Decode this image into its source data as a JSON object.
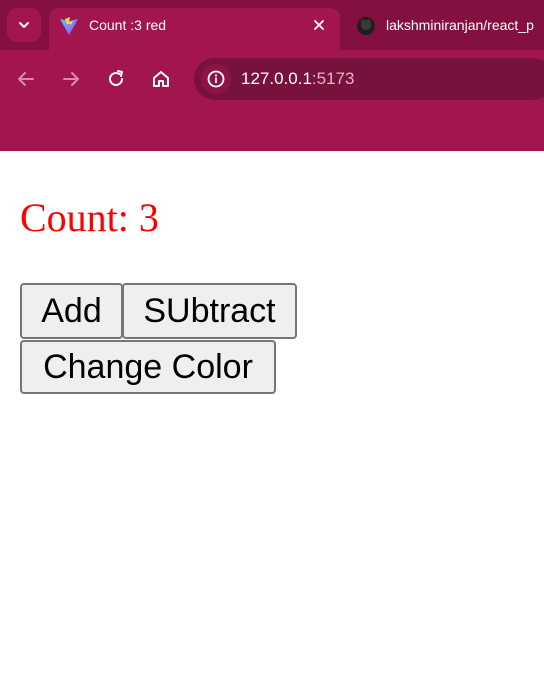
{
  "browser": {
    "tabs": [
      {
        "title": "Count :3 red",
        "active": true,
        "favicon": "vite-logo-icon"
      },
      {
        "title": "lakshminiranjan/react_p",
        "active": false,
        "favicon": "github-icon"
      }
    ],
    "url": {
      "host": "127.0.0.1",
      "port": ":5173"
    },
    "colors": {
      "frame": "#a3154d",
      "tabstrip": "#841040",
      "omnibox": "#76123b"
    }
  },
  "page": {
    "count_label": "Count: ",
    "count_value": "3",
    "text_color": "red",
    "buttons": {
      "add": "Add",
      "subtract": "SUbtract",
      "change_color": "Change Color"
    }
  }
}
